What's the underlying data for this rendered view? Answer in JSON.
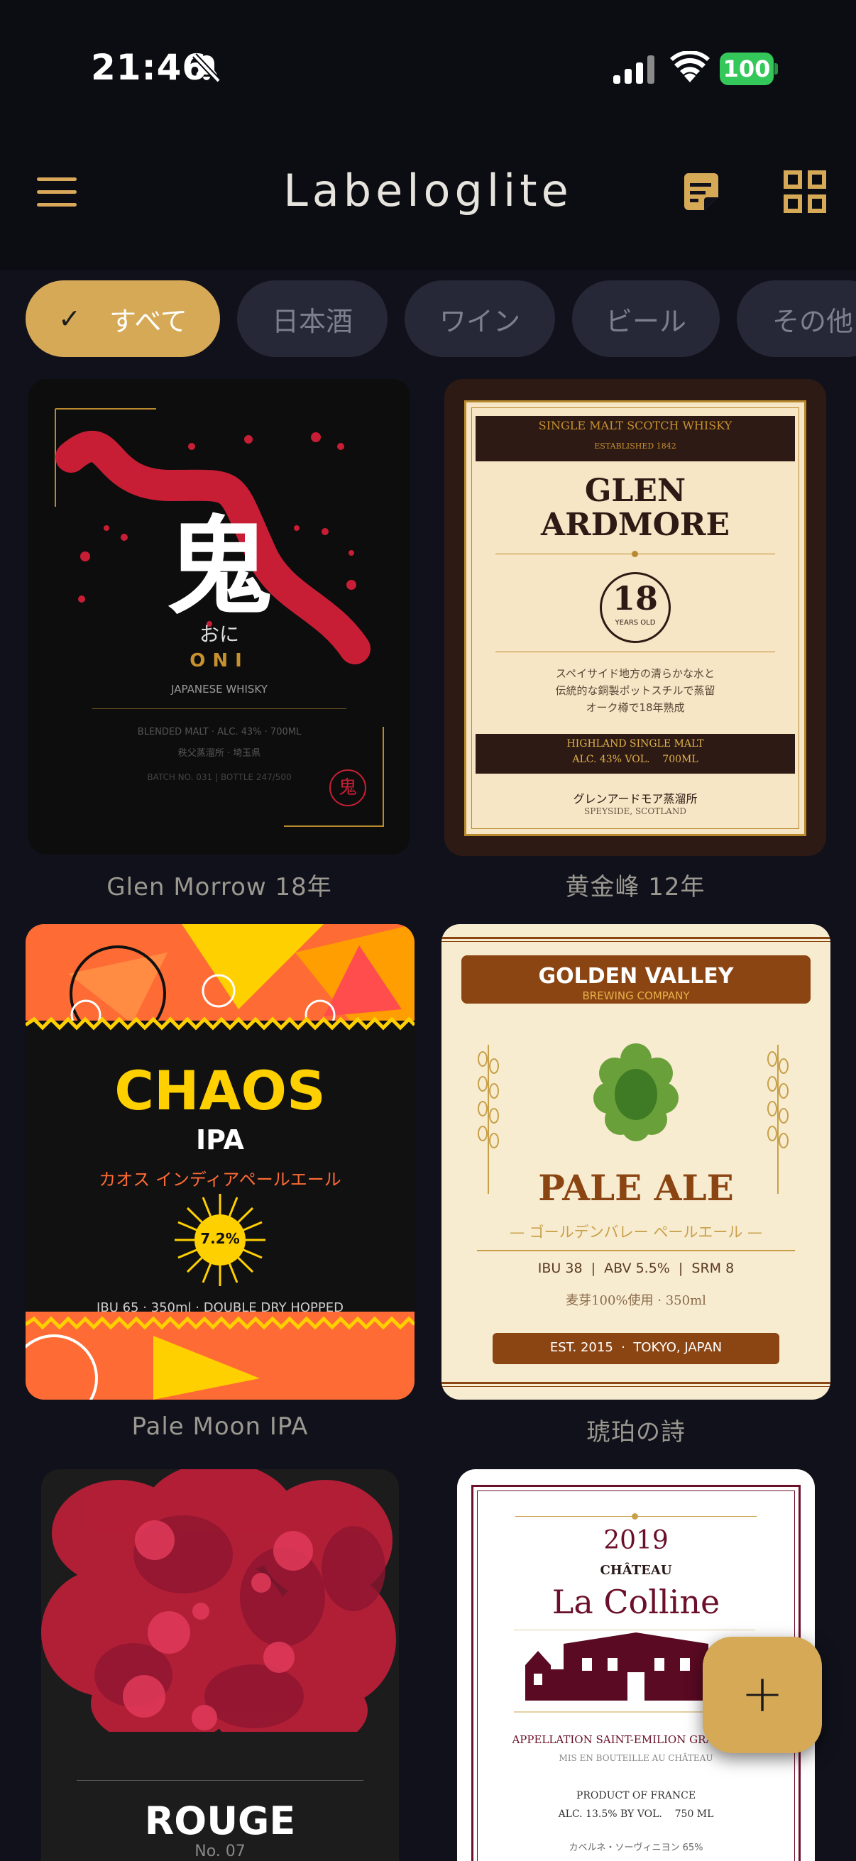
{
  "status_bar": {
    "time": "21:46",
    "battery": "100"
  },
  "app_bar": {
    "title": "Labeloglite"
  },
  "chips": [
    {
      "label": "すべて",
      "active": true
    },
    {
      "label": "日本酒"
    },
    {
      "label": "ワイン"
    },
    {
      "label": "ビール"
    },
    {
      "label": "その他"
    }
  ],
  "cards": [
    {
      "caption": "Glen Morrow 18年",
      "label": {
        "kanji": "鬼",
        "kana": "おに",
        "name": "ONI",
        "sub": "JAPANESE WHISKY",
        "line1": "BLENDED MALT  ·  ALC. 43%  ·  700ML",
        "line2": "秩父蒸溜所 · 埼玉県",
        "line3": "BATCH NO. 031  |  BOTTLE 247/500",
        "seal": "鬼"
      }
    },
    {
      "caption": "黄金峰 12年",
      "label": {
        "top1": "SINGLE MALT SCOTCH WHISKY",
        "top2": "ESTABLISHED 1842",
        "name1": "GLEN",
        "name2": "ARDMORE",
        "age": "18",
        "age_sub": "YEARS OLD",
        "desc1": "スペイサイド地方の清らかな水と",
        "desc2": "伝統的な銅製ポットスチルで蒸留",
        "desc3": "オーク樽で18年熟成",
        "band1": "HIGHLAND SINGLE MALT",
        "band2": "ALC. 43% VOL.    700ML",
        "foot1": "グレンアードモア蒸溜所",
        "foot2": "SPEYSIDE, SCOTLAND"
      }
    },
    {
      "caption": "Pale Moon IPA",
      "label": {
        "name": "CHAOS",
        "style": "IPA",
        "jp": "カオス インディアペールエール",
        "abv": "7.2%",
        "foot": "IBU 65  ·  350ml  ·  DOUBLE DRY HOPPED"
      }
    },
    {
      "caption": "琥珀の詩",
      "label": {
        "brand": "GOLDEN VALLEY",
        "brand_sub": "BREWING COMPANY",
        "name": "PALE ALE",
        "jp": "— ゴールデンバレー ペールエール —",
        "specs": "IBU 38  |  ABV 5.5%  |  SRM 8",
        "malt": "麦芽100%使用 · 350ml",
        "est": "EST. 2015  ·  TOKYO, JAPAN"
      }
    },
    {
      "caption": "",
      "label": {
        "name": "ROUGE",
        "no": "No. 07"
      }
    },
    {
      "caption": "",
      "label": {
        "year": "2019",
        "chateau": "CHÂTEAU",
        "name": "La Colline",
        "appellation": "APPELLATION SAINT-EMILION GRAND CRU",
        "bottled": "MIS EN BOUTEILLE AU CHÂTEAU",
        "product": "PRODUCT OF FRANCE",
        "alc": "ALC. 13.5% BY VOL.    750 ML",
        "grape": "カベルネ・ソーヴィニヨン 65%"
      }
    }
  ],
  "fab": {
    "label": "+"
  }
}
